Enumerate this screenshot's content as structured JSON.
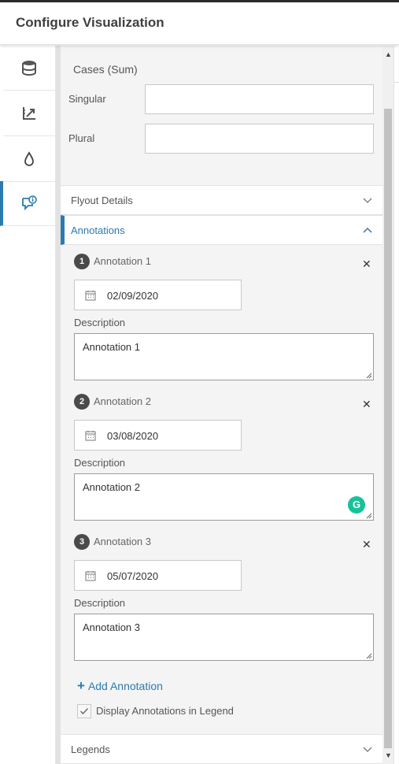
{
  "header": {
    "title": "Configure Visualization"
  },
  "nav": {
    "items": [
      {
        "icon": "database-icon"
      },
      {
        "icon": "chart-axis-icon"
      },
      {
        "icon": "color-drop-icon"
      },
      {
        "icon": "annotation-comment-icon",
        "active": true
      }
    ]
  },
  "cases": {
    "title": "Cases (Sum)",
    "singular_label": "Singular",
    "singular_value": "",
    "plural_label": "Plural",
    "plural_value": ""
  },
  "sections": {
    "flyout": "Flyout Details",
    "annotations": "Annotations",
    "legends": "Legends"
  },
  "annotations": [
    {
      "number": "1",
      "title": "Annotation 1",
      "date": "02/09/2020",
      "description_label": "Description",
      "description": "Annotation 1"
    },
    {
      "number": "2",
      "title": "Annotation 2",
      "date": "03/08/2020",
      "description_label": "Description",
      "description": "Annotation 2"
    },
    {
      "number": "3",
      "title": "Annotation 3",
      "date": "05/07/2020",
      "description_label": "Description",
      "description": "Annotation 3"
    }
  ],
  "add_annotation_label": "Add Annotation",
  "legend_checkbox": {
    "label": "Display Annotations in Legend",
    "checked": true
  },
  "colors": {
    "accent": "#2a7bb0",
    "badge": "#4a4a4a",
    "grammarly": "#15c39a"
  }
}
